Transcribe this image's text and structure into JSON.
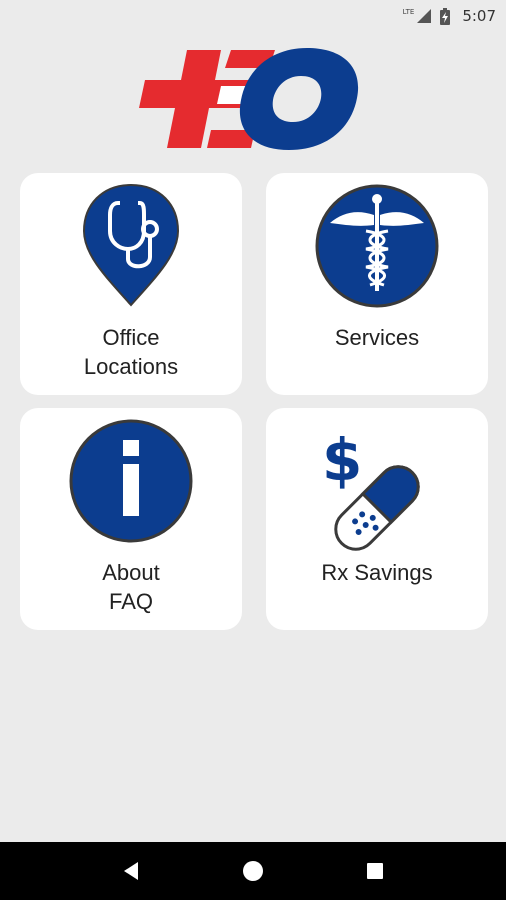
{
  "status_bar": {
    "network": "LTE",
    "time": "5:07",
    "icons": [
      "signal-icon",
      "battery-icon"
    ]
  },
  "app": {
    "logo_text": "EO",
    "brand_colors": {
      "red": "#e52b2f",
      "blue": "#0c3d8f",
      "tile_bg": "#ffffff",
      "page_bg": "#ebebeb"
    }
  },
  "tiles": [
    {
      "label": "Office\nLocations",
      "icon": "stethoscope-pin-icon"
    },
    {
      "label": "Services",
      "icon": "caduceus-icon"
    },
    {
      "label": "About\nFAQ",
      "icon": "info-icon"
    },
    {
      "label": "Rx Savings",
      "icon": "dollar-pill-icon"
    }
  ],
  "nav_bar": {
    "buttons": [
      "back-icon",
      "home-icon",
      "recents-icon"
    ]
  }
}
